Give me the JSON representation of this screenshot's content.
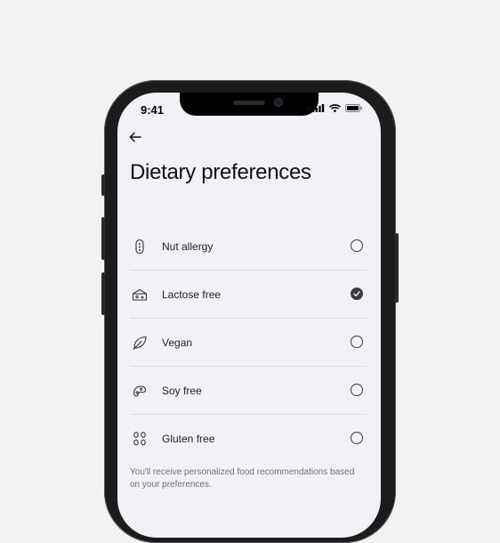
{
  "status": {
    "time": "9:41"
  },
  "header": {
    "back_icon": "arrow-left-icon",
    "title": "Dietary preferences"
  },
  "options": [
    {
      "label": "Nut allergy",
      "icon": "nut-icon",
      "checked": false
    },
    {
      "label": "Lactose free",
      "icon": "cheese-icon",
      "checked": true
    },
    {
      "label": "Vegan",
      "icon": "leaf-icon",
      "checked": false
    },
    {
      "label": "Soy free",
      "icon": "soy-icon",
      "checked": false
    },
    {
      "label": "Gluten free",
      "icon": "grain-icon",
      "checked": false
    }
  ],
  "footer": {
    "note": "You'll receive personalized food recommendations based on your preferences."
  },
  "colors": {
    "background": "#f2f2f2",
    "screen": "#f2f1f6",
    "frame": "#1c1c1e",
    "checked": "#3c3c3e"
  }
}
